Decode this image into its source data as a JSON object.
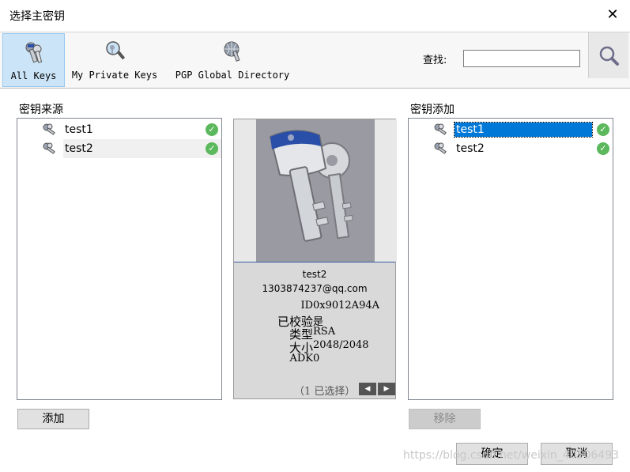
{
  "window": {
    "title": "选择主密钥",
    "close_glyph": "✕"
  },
  "toolbar": {
    "items": [
      {
        "label": "All Keys",
        "icon": "all-keys-icon",
        "active": true
      },
      {
        "label": "My Private Keys",
        "icon": "private-keys-icon",
        "active": false
      },
      {
        "label": "PGP Global Directory",
        "icon": "global-directory-icon",
        "active": false
      }
    ],
    "find_label": "查找:",
    "find_value": "",
    "search_icon": "magnifier-icon"
  },
  "source": {
    "label": "密钥来源",
    "keys": [
      {
        "name": "test1",
        "valid": true
      },
      {
        "name": "test2",
        "valid": true
      }
    ]
  },
  "preview": {
    "name": "test2",
    "email": "1303874237@qq.com",
    "fields": [
      {
        "key": "ID",
        "value": "0x9012A94A"
      },
      {
        "key": "已校验",
        "value": "是"
      },
      {
        "key": "类型",
        "value": "RSA"
      },
      {
        "key": "大小",
        "value": "2048/2048"
      },
      {
        "key": "ADK",
        "value": "0"
      }
    ],
    "selection": "（1 已选择）",
    "prev_glyph": "◀",
    "next_glyph": "▶"
  },
  "added": {
    "label": "密钥添加",
    "keys": [
      {
        "name": "test1",
        "valid": true,
        "selected": true
      },
      {
        "name": "test2",
        "valid": true,
        "selected": false
      }
    ]
  },
  "buttons": {
    "add": "添加",
    "remove": "移除",
    "ok": "确定",
    "cancel": "取消"
  },
  "watermark": "https://blog.csdn.net/weixin_40506493",
  "colors": {
    "accent": "#0078d7",
    "check": "#5cb85c",
    "active_tool": "#cce4f7"
  }
}
